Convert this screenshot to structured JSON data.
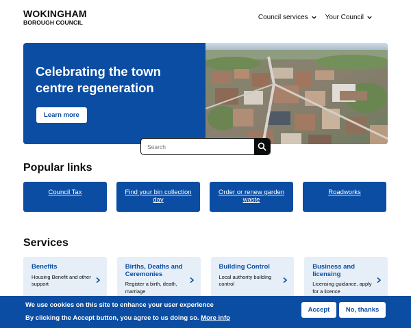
{
  "header": {
    "logo_line1": "WOKINGHAM",
    "logo_line2": "BOROUGH COUNCIL",
    "nav": [
      {
        "label": "Council services",
        "icon": "chevron-down-icon"
      },
      {
        "label": "Your Council",
        "icon": "chevron-down-icon"
      }
    ]
  },
  "hero": {
    "title": "Celebrating the town centre regeneration",
    "button_label": "Learn more",
    "image": "aerial-town-photo"
  },
  "search": {
    "placeholder": "Search",
    "icon": "search-icon"
  },
  "popular_links": {
    "heading": "Popular links",
    "items": [
      {
        "label": "Council Tax"
      },
      {
        "label": "Find your bin collection day"
      },
      {
        "label": "Order or renew garden waste"
      },
      {
        "label": "Roadworks"
      }
    ]
  },
  "services": {
    "heading": "Services",
    "items": [
      {
        "name": "Benefits",
        "desc": "Housing Benefit and other support"
      },
      {
        "name": "Births, Deaths and Ceremonies",
        "desc": "Register a birth, death, marriage"
      },
      {
        "name": "Building Control",
        "desc": "Local authority building control"
      },
      {
        "name": "Business and licensing",
        "desc": "Licensing guidance, apply for a licence"
      }
    ]
  },
  "cookie_banner": {
    "title": "We use cookies on this site to enhance your user experience",
    "text": "By clicking the Accept button, you agree to us doing so.",
    "link_label": "More info",
    "accept_label": "Accept",
    "decline_label": "No, thanks"
  },
  "colors": {
    "brand_blue": "#0b4da2",
    "card_bg": "#e6eef8",
    "text": "#0b0c0c"
  }
}
